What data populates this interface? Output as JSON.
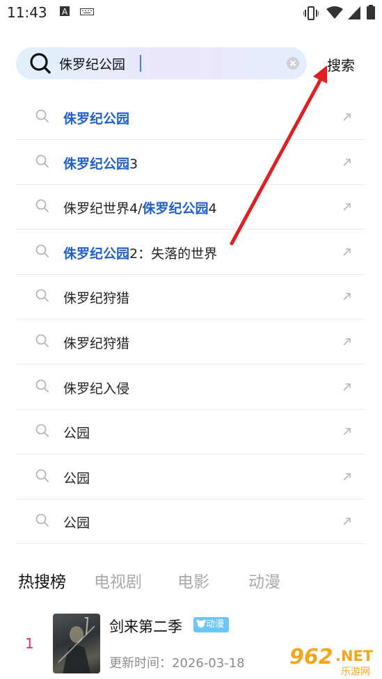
{
  "status_bar": {
    "time": "11:43"
  },
  "search": {
    "query": "侏罗纪公园",
    "submit_label": "搜索"
  },
  "suggestions": [
    {
      "before": "",
      "highlight": "侏罗纪公园",
      "after": ""
    },
    {
      "before": "",
      "highlight": "侏罗纪公园",
      "after": "3"
    },
    {
      "before": "侏罗纪世界4/",
      "highlight": "侏罗纪公园",
      "after": "4"
    },
    {
      "before": "",
      "highlight": "侏罗纪公园",
      "after": "2：失落的世界"
    },
    {
      "before": "侏罗纪狩猎",
      "highlight": "",
      "after": ""
    },
    {
      "before": "侏罗纪狩猎",
      "highlight": "",
      "after": ""
    },
    {
      "before": "侏罗纪入侵",
      "highlight": "",
      "after": ""
    },
    {
      "before": "公园",
      "highlight": "",
      "after": ""
    },
    {
      "before": "公园",
      "highlight": "",
      "after": ""
    },
    {
      "before": "公园",
      "highlight": "",
      "after": ""
    }
  ],
  "hot": {
    "tabs": [
      "热搜榜",
      "电视剧",
      "电影",
      "动漫"
    ],
    "items": [
      {
        "rank": "1",
        "title": "剑来第二季",
        "badge": "动漫",
        "updated": "更新时间：2026-03-18"
      }
    ]
  },
  "watermark": {
    "brand": "962",
    "suffix": ".NET",
    "sub": "乐游网"
  },
  "colors": {
    "highlight": "#1f5fd1",
    "rank": "#e0257e",
    "badge": "#6ec6f6",
    "annotation_arrow": "#e02020"
  }
}
